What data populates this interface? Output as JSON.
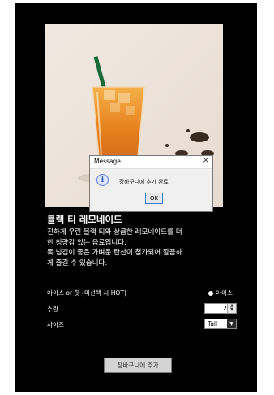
{
  "dialog": {
    "title": "Message",
    "close_glyph": "×",
    "message": "장바구니에 추가 완료",
    "ok_label": "OK",
    "icon": "info-icon"
  },
  "product": {
    "image": "iced-black-tea-lemonade-photo",
    "name": "블랙 티 레모네이드",
    "description_lines": [
      "진하게 우린 블랙 티와 상큼한 레모네이드를 더",
      "한 청량감 있는 음료입니다.",
      "목 넘김이 좋은 가벼운 탄산이 첨가되어 깔끔하",
      "게 즐길 수 있습니다."
    ]
  },
  "options": {
    "temperature_label": "아이스 or 핫 (미선택 시 HOT)",
    "temperature_choice": "아이스",
    "quantity_label": "수량",
    "quantity_value": "2",
    "size_label": "사이즈",
    "size_value": "Tall"
  },
  "cart_button_label": "장바구니에 추가",
  "colors": {
    "window_bg": "#000000",
    "text": "#ffffff",
    "dialog_bg": "#f0f0f0",
    "button_bg": "#d4d4d4"
  }
}
